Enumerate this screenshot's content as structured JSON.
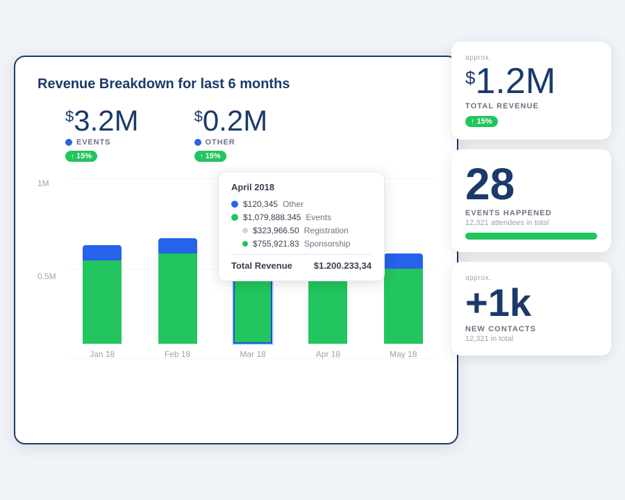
{
  "chart_card": {
    "title": "Revenue Breakdown for last 6 months",
    "metrics": [
      {
        "value": "3.2M",
        "dollar": "$",
        "label": "EVENTS",
        "dot_color": "blue",
        "badge": "↑ 15%"
      },
      {
        "value": "0.2M",
        "dollar": "$",
        "label": "OTHER",
        "dot_color": "blue",
        "badge": "↑ 15%"
      }
    ],
    "y_labels": [
      "1M",
      "0.5M",
      ""
    ],
    "bars": [
      {
        "label": "Jan 18",
        "bottom_h": 120,
        "top_h": 22
      },
      {
        "label": "Feb 18",
        "bottom_h": 130,
        "top_h": 22
      },
      {
        "label": "Mar 18",
        "bottom_h": 200,
        "top_h": 30
      },
      {
        "label": "Apr 18",
        "bottom_h": 145,
        "top_h": 22
      },
      {
        "label": "May 18",
        "bottom_h": 110,
        "top_h": 22
      }
    ],
    "tooltip": {
      "title": "April 2018",
      "rows": [
        {
          "dot": "blue",
          "amount": "$120,345",
          "label": "Other"
        },
        {
          "dot": "green",
          "amount": "$1,079,888.345",
          "label": "Events"
        },
        {
          "dot": "white",
          "amount": "$323,966.50",
          "label": "Registration"
        },
        {
          "dot": "green-sm",
          "amount": "$755,921.83",
          "label": "Sponsorship"
        }
      ],
      "total_label": "Total Revenue",
      "total_value": "$1.200.233,34"
    }
  },
  "side_cards": [
    {
      "id": "revenue",
      "approx": "approx.",
      "value": "1.2M",
      "dollar": "$",
      "label": "TOTAL REVENUE",
      "badge": "↑ 15%"
    },
    {
      "id": "events",
      "value": "28",
      "label": "EVENTS HAPPENED",
      "sub": "12,321 attendees in total",
      "bar": true
    },
    {
      "id": "contacts",
      "approx": "approx.",
      "value": "+1k",
      "label": "NEW CONTACTS",
      "sub": "12,321 in total"
    }
  ]
}
